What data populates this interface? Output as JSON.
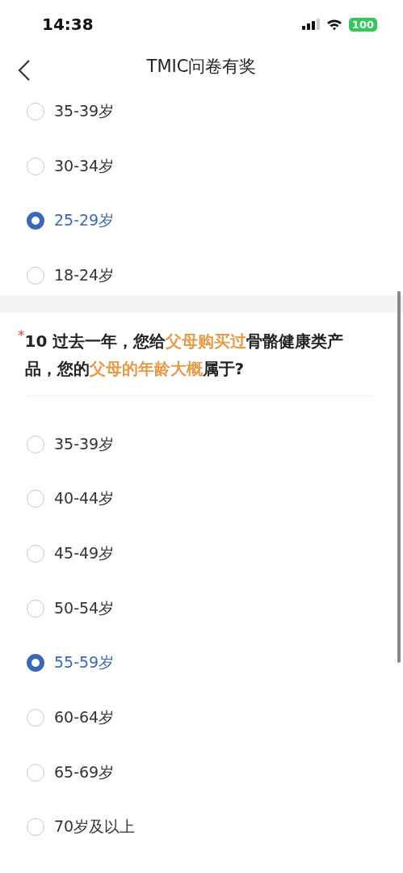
{
  "status_bar": {
    "time": "14:38",
    "battery": "100"
  },
  "nav": {
    "title": "TMIC问卷有奖"
  },
  "sections": [
    {
      "options": [
        {
          "label": "35-39岁",
          "selected": false
        },
        {
          "label": "30-34岁",
          "selected": false
        },
        {
          "label": "25-29岁",
          "selected": true
        },
        {
          "label": "18-24岁",
          "selected": false
        }
      ]
    },
    {
      "required_mark": "*",
      "number": "10",
      "question": [
        {
          "text": "过去一年，您给",
          "highlight": false
        },
        {
          "text": "父母购买过",
          "highlight": true
        },
        {
          "text": "骨骼健康类产品，您的",
          "highlight": false
        },
        {
          "text": "父母的年龄大概",
          "highlight": true
        },
        {
          "text": "属于?",
          "highlight": false
        }
      ],
      "options": [
        {
          "label": "35-39岁",
          "selected": false
        },
        {
          "label": "40-44岁",
          "selected": false
        },
        {
          "label": "45-49岁",
          "selected": false
        },
        {
          "label": "50-54岁",
          "selected": false
        },
        {
          "label": "55-59岁",
          "selected": true
        },
        {
          "label": "60-64岁",
          "selected": false
        },
        {
          "label": "65-69岁",
          "selected": false
        },
        {
          "label": "70岁及以上",
          "selected": false
        }
      ]
    }
  ]
}
